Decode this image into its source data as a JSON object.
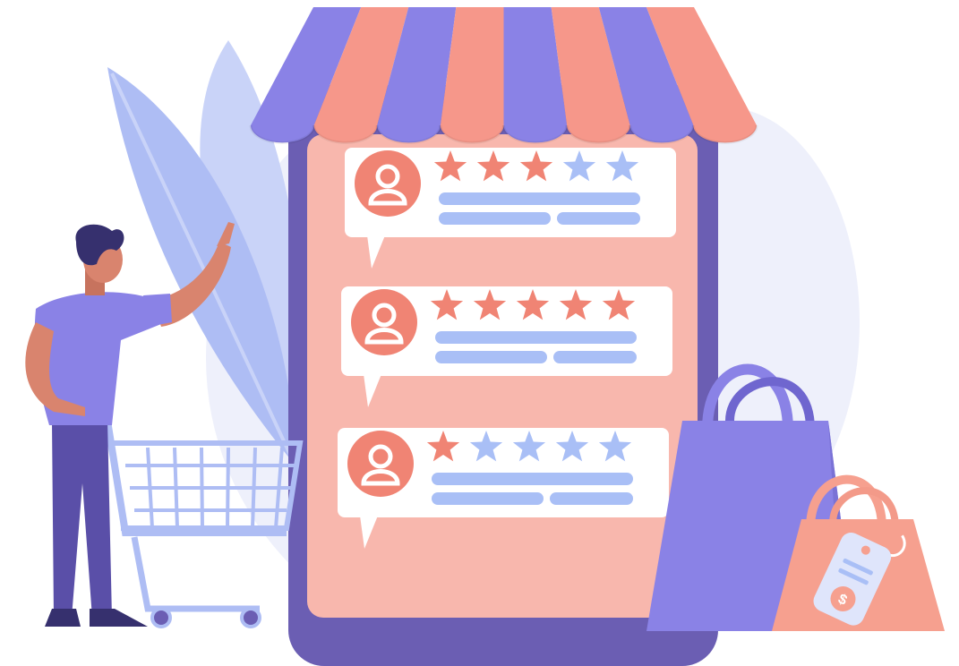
{
  "colors": {
    "background": "#ffffff",
    "blob": "#eef0fb",
    "leaf_light": "#c9d3f8",
    "leaf_mid": "#aebdf4",
    "phone_body": "#6b5eb3",
    "phone_screen": "#f8b7ad",
    "awning_purple": "#8a82e6",
    "awning_coral": "#f6978a",
    "card": "#ffffff",
    "avatar": "#f08474",
    "star_filled": "#f08474",
    "star_empty": "#a9bff6",
    "text_line": "#a9bff6",
    "bag_purple": "#8a82e6",
    "bag_coral": "#f6a08f",
    "skin": "#d9846e",
    "shirt": "#8a82e6",
    "pants": "#5a4fa8",
    "hair": "#36306e",
    "cart": "#aebdf4"
  },
  "reviews": [
    {
      "rating": 3,
      "max": 5
    },
    {
      "rating": 5,
      "max": 5
    },
    {
      "rating": 1,
      "max": 5
    }
  ],
  "icons": {
    "reviewer": "user-avatar-icon",
    "star": "star-icon",
    "price_tag": "dollar-price-tag-icon",
    "cart": "shopping-cart-icon",
    "bag": "shopping-bag-icon"
  }
}
